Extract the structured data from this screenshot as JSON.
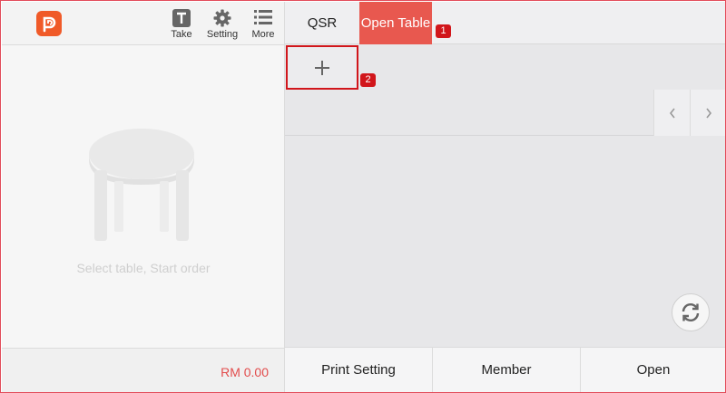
{
  "toolbar": {
    "logo_icon": "app-logo-icon",
    "take": {
      "label": "Take",
      "icon": "T-icon"
    },
    "setting": {
      "label": "Setting",
      "icon": "gear-icon"
    },
    "more": {
      "label": "More",
      "icon": "list-icon"
    }
  },
  "left_panel": {
    "empty_icon": "table-icon",
    "empty_text": "Select table, Start order",
    "total": "RM 0.00"
  },
  "tabs": [
    {
      "label": "QSR",
      "active": false
    },
    {
      "label": "Open Table",
      "active": true
    }
  ],
  "annotations": [
    {
      "label": "1"
    },
    {
      "label": "2"
    }
  ],
  "add_tile": {
    "icon": "plus-icon"
  },
  "nav": {
    "prev_icon": "chevron-left-icon",
    "next_icon": "chevron-right-icon"
  },
  "refresh_icon": "refresh-icon",
  "footer_buttons": [
    {
      "label": "Print Setting"
    },
    {
      "label": "Member"
    },
    {
      "label": "Open"
    }
  ],
  "colors": {
    "accent": "#e8584f",
    "annotation": "#d1161b",
    "brand": "#f05a28",
    "total_text": "#e24c4c"
  }
}
